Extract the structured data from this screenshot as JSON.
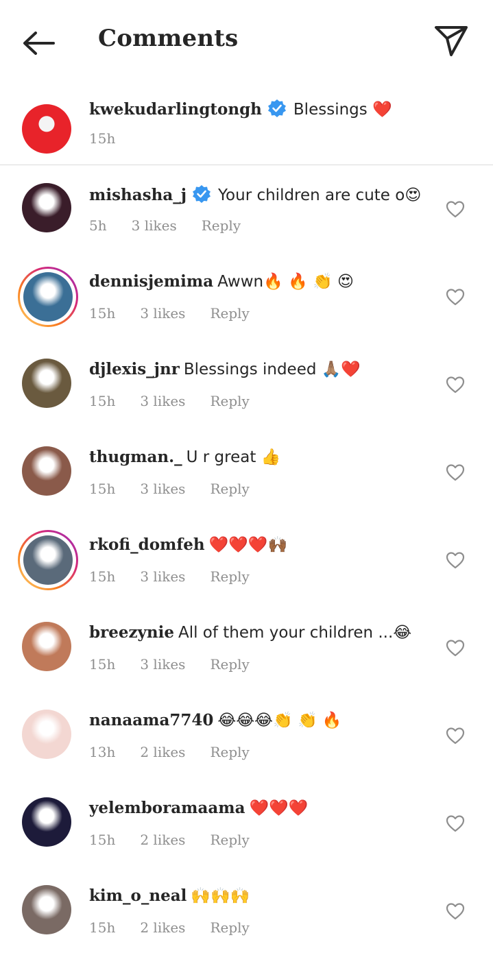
{
  "header": {
    "title": "Comments",
    "back_icon": "arrow-left-icon",
    "send_icon": "paper-plane-icon"
  },
  "caption": {
    "username": "kwekudarlingtongh",
    "verified": true,
    "text": "Blessings ❤️",
    "time": "15h",
    "avatar_color": "#e8232a"
  },
  "comments": [
    {
      "username": "mishasha_j",
      "verified": true,
      "text": "Your children are cute o😍",
      "time": "5h",
      "likes": "3 likes",
      "reply": "Reply",
      "story_ring": false,
      "avatar_color": "#3a1d2a"
    },
    {
      "username": "dennisjemima",
      "verified": false,
      "text": "Awwn🔥 🔥 👏 😍",
      "time": "15h",
      "likes": "3 likes",
      "reply": "Reply",
      "story_ring": true,
      "avatar_color": "#3b6f96"
    },
    {
      "username": "djlexis_jnr",
      "verified": false,
      "text": "Blessings indeed 🙏🏽❤️",
      "time": "15h",
      "likes": "3 likes",
      "reply": "Reply",
      "story_ring": false,
      "avatar_color": "#6a5a3f"
    },
    {
      "username": "thugman._",
      "verified": false,
      "text": "U r great 👍",
      "time": "15h",
      "likes": "3 likes",
      "reply": "Reply",
      "story_ring": false,
      "avatar_color": "#8a5a4a"
    },
    {
      "username": "rkofi_domfeh",
      "verified": false,
      "text": "❤️❤️❤️🙌🏾",
      "time": "15h",
      "likes": "3 likes",
      "reply": "Reply",
      "story_ring": true,
      "avatar_color": "#5a6a7a"
    },
    {
      "username": "breezynie",
      "verified": false,
      "text": "All of them your children ...😂",
      "time": "15h",
      "likes": "3 likes",
      "reply": "Reply",
      "story_ring": false,
      "avatar_color": "#c07a5a"
    },
    {
      "username": "nanaama7740",
      "verified": false,
      "text": "😂😂😂👏 👏 🔥",
      "time": "13h",
      "likes": "2 likes",
      "reply": "Reply",
      "story_ring": false,
      "avatar_color": "#f3d7d2"
    },
    {
      "username": "yelemboramaama",
      "verified": false,
      "text": "❤️❤️❤️",
      "time": "15h",
      "likes": "2 likes",
      "reply": "Reply",
      "story_ring": false,
      "avatar_color": "#1d1b3a"
    },
    {
      "username": "kim_o_neal",
      "verified": false,
      "text": "🙌🙌🙌",
      "time": "15h",
      "likes": "2 likes",
      "reply": "Reply",
      "story_ring": false,
      "avatar_color": "#7a6a64"
    }
  ],
  "colors": {
    "text": "#262626",
    "muted": "#8e8e8e",
    "verified": "#3897f0",
    "divider": "#dbdbdb"
  }
}
